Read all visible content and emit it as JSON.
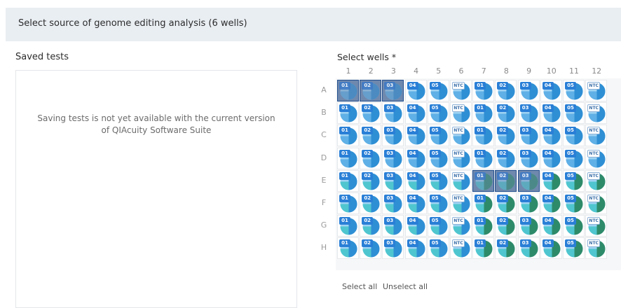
{
  "header": {
    "title": "Select source of genome editing analysis (6 wells)"
  },
  "saved_tests": {
    "title": "Saved tests",
    "message": "Saving tests is not yet available with the current version of QIAcuity Software Suite"
  },
  "wells": {
    "title": "Select wells *",
    "columns": [
      "1",
      "2",
      "3",
      "4",
      "5",
      "6",
      "7",
      "8",
      "9",
      "10",
      "11",
      "12"
    ],
    "rows": [
      "A",
      "B",
      "C",
      "D",
      "E",
      "F",
      "G",
      "H"
    ],
    "column_labels": [
      "01",
      "02",
      "03",
      "04",
      "05",
      "NTC",
      "01",
      "02",
      "03",
      "04",
      "05",
      "NTC"
    ],
    "selected": [
      "A1",
      "A2",
      "A3",
      "E7",
      "E8",
      "E9"
    ],
    "select_all": "Select all",
    "unselect_all": "Unselect all"
  },
  "colors": {
    "selected_fill": "#6f88ad",
    "selected_border": "#24508f",
    "blue_light": "#9fd3f3",
    "blue_mid": "#5fb0e6",
    "blue_dark": "#2f8fd4",
    "teal": "#4fc6cf",
    "green": "#2e8b6a"
  }
}
